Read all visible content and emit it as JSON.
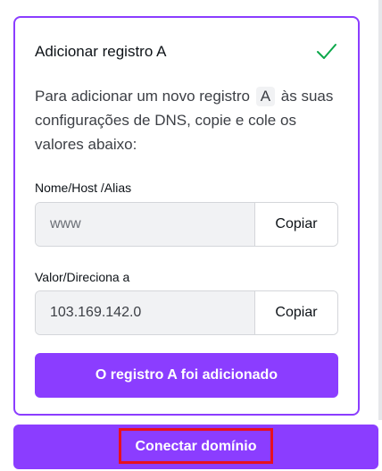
{
  "card": {
    "title": "Adicionar registro A",
    "status_icon": "checkmark-icon",
    "description_before": "Para adicionar um novo registro",
    "record_type": "A",
    "description_after": "às suas configurações de DNS, copie e cole os valores abaixo:"
  },
  "host_field": {
    "label": "Nome/Host /Alias",
    "value": "www",
    "copy_label": "Copiar"
  },
  "value_field": {
    "label": "Valor/Direciona a",
    "value": "103.169.142.0",
    "copy_label": "Copiar"
  },
  "added_button_label": "O registro A foi adicionado",
  "connect_button_label": "Conectar domínio",
  "colors": {
    "accent": "#8b3dff",
    "success": "#0ba84a",
    "highlight": "#e8101e"
  }
}
